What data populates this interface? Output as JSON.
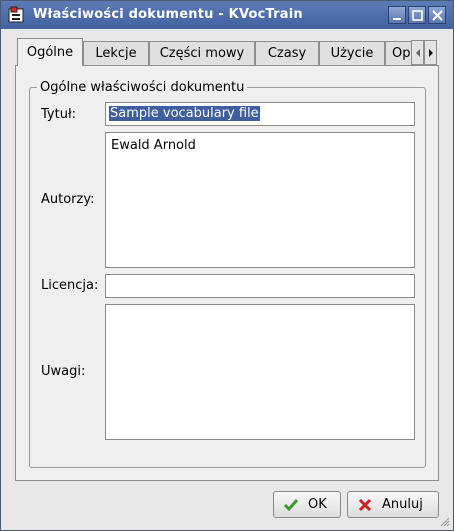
{
  "window": {
    "title": "Właściwości dokumentu - KVocTrain"
  },
  "tabs": [
    {
      "label": "Ogólne",
      "active": true
    },
    {
      "label": "Lekcje",
      "active": false
    },
    {
      "label": "Części mowy",
      "active": false
    },
    {
      "label": "Czasy",
      "active": false
    },
    {
      "label": "Użycie",
      "active": false
    },
    {
      "label": "Op",
      "active": false
    }
  ],
  "group": {
    "title": "Ogólne właściwości dokumentu"
  },
  "form": {
    "title_label": "Tytuł:",
    "title_value": "Sample vocabulary file",
    "authors_label": "Autorzy:",
    "authors_value": "Ewald Arnold",
    "license_label": "Licencja:",
    "license_value": "",
    "notes_label": "Uwagi:",
    "notes_value": ""
  },
  "buttons": {
    "ok": "OK",
    "cancel": "Anuluj"
  },
  "colors": {
    "titlebar": "#40629f",
    "selection": "#3e5e9f",
    "ok_icon": "#3a9a2a",
    "cancel_icon": "#cc2222"
  }
}
